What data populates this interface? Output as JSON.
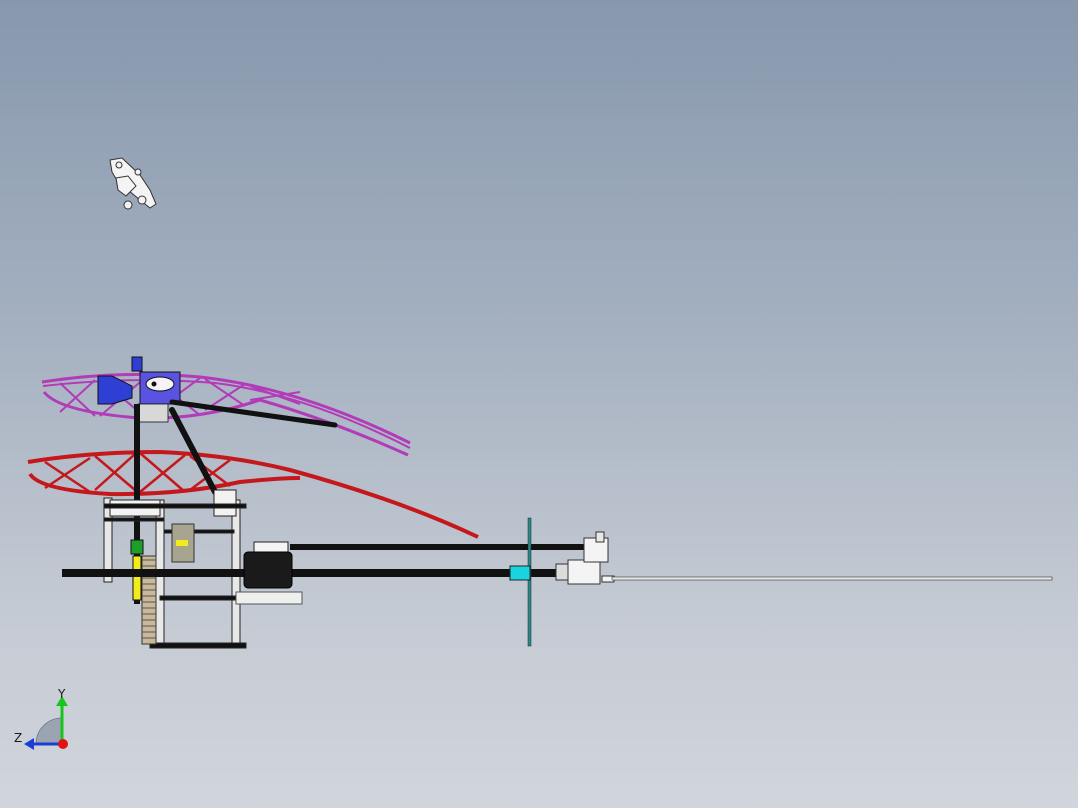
{
  "viewport": {
    "background_top": "#8798ad",
    "background_bottom": "#d1d5dc"
  },
  "model": {
    "parts": [
      "servo-arm-linkage",
      "upper-rotor-blade",
      "lower-rotor-blade",
      "main-shaft",
      "main-frame",
      "main-gear",
      "servo",
      "tail-boom",
      "tail-gearbox",
      "tail-rotor-blade",
      "tail-rotor-shaft"
    ],
    "colors": {
      "upper_blade": "#b23bb8",
      "lower_blade": "#c4181c",
      "shaft": "#111111",
      "head_block": "#2f3fd6",
      "servo_body": "#1a1a1a",
      "cyan_block": "#19d4df",
      "yellow_part": "#f2ec1c",
      "green_part": "#1f9d2a",
      "frame": "#e6e6e6"
    }
  },
  "triad": {
    "y_label": "Y",
    "z_label": "Z",
    "x_color": "#e01414",
    "y_color": "#19c41c",
    "z_color": "#1b3fd6"
  }
}
